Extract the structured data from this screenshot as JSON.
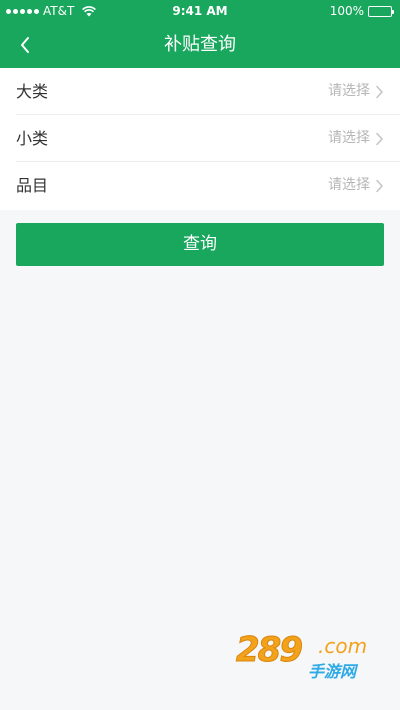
{
  "status_bar": {
    "carrier": "AT&T",
    "time": "9:41 AM",
    "battery": "100%",
    "battery_level": 1.0
  },
  "nav": {
    "title": "补贴查询"
  },
  "form": {
    "rows": [
      {
        "label": "大类",
        "value": "请选择"
      },
      {
        "label": "小类",
        "value": "请选择"
      },
      {
        "label": "品目",
        "value": "请选择"
      }
    ]
  },
  "actions": {
    "query_label": "查询"
  },
  "watermark": {
    "number": "289",
    "suffix": ".com",
    "subtitle": "手游网"
  },
  "colors": {
    "brand_green": "#19a75e",
    "background": "#f6f7f9",
    "placeholder_gray": "#b6b6b6"
  }
}
